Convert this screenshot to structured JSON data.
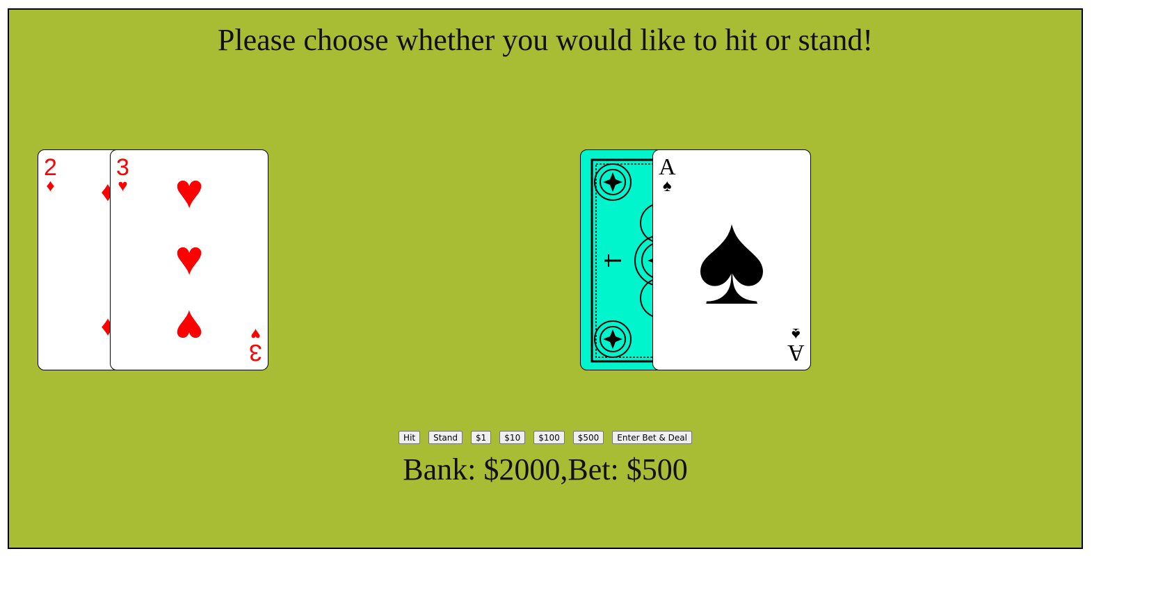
{
  "message": "Please choose whether you would like to hit or stand!",
  "player_cards": [
    {
      "rank": "2",
      "suit": "♦",
      "color": "#ff0000"
    },
    {
      "rank": "3",
      "suit": "♥",
      "color": "#ff0000"
    }
  ],
  "dealer_cards": [
    {
      "face_down": true,
      "back_color": "#00f5cc"
    },
    {
      "rank": "A",
      "suit": "♠",
      "color": "#000000"
    }
  ],
  "buttons": {
    "hit": "Hit",
    "stand": "Stand",
    "bet1": "$1",
    "bet10": "$10",
    "bet100": "$100",
    "bet500": "$500",
    "deal": "Enter Bet & Deal"
  },
  "status": "Bank: $2000,Bet: $500",
  "colors": {
    "table": "#a8bd33",
    "red_suit": "#ff0000",
    "card_back": "#00f5cc"
  }
}
